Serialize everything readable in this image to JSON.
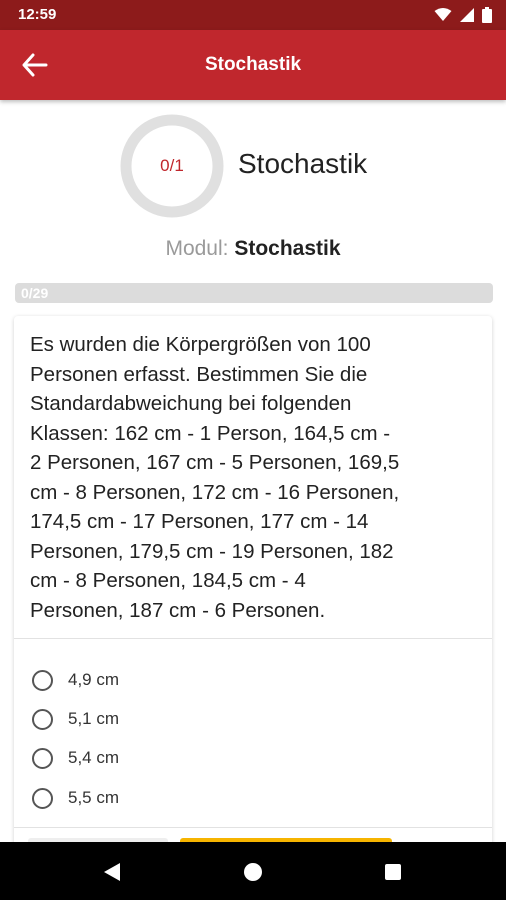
{
  "status_bar": {
    "time": "12:59",
    "icons": [
      "wifi-icon",
      "signal-icon",
      "battery-icon"
    ]
  },
  "app_bar": {
    "title": "Stochastik",
    "back_icon": "arrow-left-icon"
  },
  "header": {
    "progress_label": "0/1",
    "progress_fraction": 0,
    "title": "Stochastik",
    "modul_label": "Modul:",
    "modul_value": "Stochastik"
  },
  "question_progress": {
    "label": "0/29",
    "fraction": 0
  },
  "question": {
    "lines": [
      "Es wurden die Körpergrößen von 100",
      "Personen erfasst. Bestimmen Sie die",
      "Standardabweichung bei folgenden",
      "Klassen: 162 cm - 1 Person, 164,5 cm -",
      "2 Personen, 167 cm - 5 Personen, 169,5",
      "cm - 8 Personen, 172 cm - 16 Personen,",
      "174,5 cm - 17 Personen, 177 cm - 14",
      "Personen, 179,5 cm - 19 Personen, 182",
      "cm - 8 Personen, 184,5 cm - 4",
      "Personen, 187 cm - 6 Personen."
    ]
  },
  "answers": [
    {
      "label": "4,9 cm",
      "selected": false
    },
    {
      "label": "5,1 cm",
      "selected": false
    },
    {
      "label": "5,4 cm",
      "selected": false
    },
    {
      "label": "5,5 cm",
      "selected": false
    }
  ],
  "colors": {
    "status_bar": "#8d1b1b",
    "app_bar": "#c0272d",
    "ring_track": "#e0e0e0",
    "primary_button": "#f6b400"
  },
  "nav": [
    "back-triangle-icon",
    "home-circle-icon",
    "recents-square-icon"
  ]
}
